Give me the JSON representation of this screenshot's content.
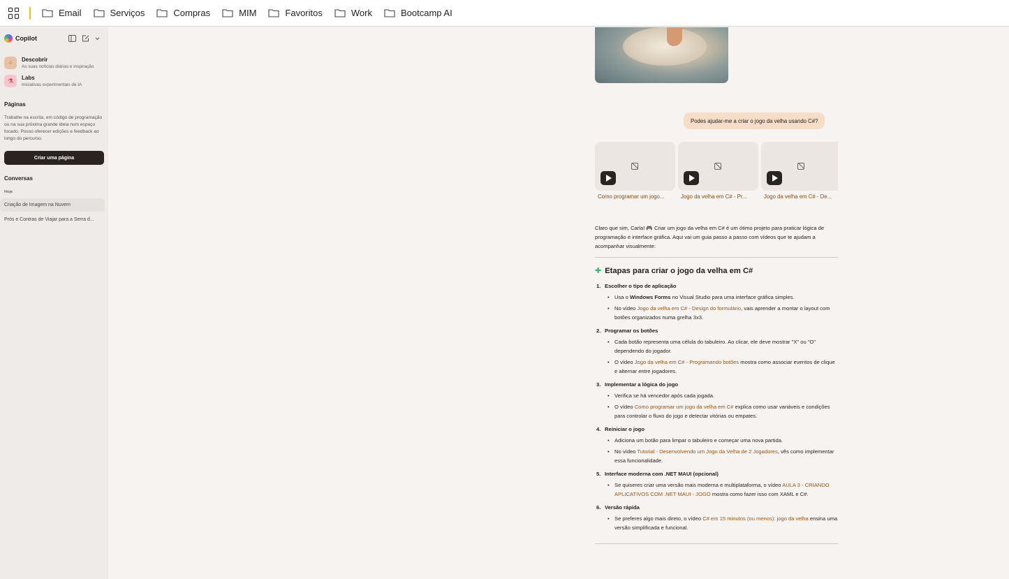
{
  "bookmarks_bar": {
    "items": [
      "Email",
      "Serviços",
      "Compras",
      "MIM",
      "Favoritos",
      "Work",
      "Bootcamp AI"
    ]
  },
  "sidebar": {
    "brand": "Copilot",
    "nav": [
      {
        "title": "Descobrir",
        "subtitle": "As suas notícias diárias e inspiração"
      },
      {
        "title": "Labs",
        "subtitle": "Iniciativas experimentais de IA"
      }
    ],
    "pages_title": "Páginas",
    "pages_text": "Trabalhe na escrita, em código de programação ou na sua próxima grande ideia num espaço focado. Posso oferecer edições e feedback ao longo do percurso.",
    "create_button": "Criar uma página",
    "conversations_title": "Conversas",
    "today_label": "Hoje",
    "conversations": [
      "Criação de Imagem na Nuvem",
      "Prós e Contras de Viajar para a Serra d..."
    ]
  },
  "chat": {
    "user_message": "Podes ajudar-me a criar o jogo da velha usando C#?",
    "videos": [
      "Como programar um jogo...",
      "Jogo da velha em C# - Pr...",
      "Jogo da velha em C# - De..."
    ],
    "intro": "Claro que sim, Carla! 🎮 Criar um jogo da velha em C# é um ótimo projeto para praticar lógica de programação e interface gráfica. Aqui vai um guia passo a passo com vídeos que te ajudam a acompanhar visualmente:",
    "heading": "Etapas para criar o jogo da velha em C#",
    "steps": [
      {
        "num": "1.",
        "title": "Escolher o tipo de aplicação"
      },
      {
        "num": "2.",
        "title": "Programar os botões"
      },
      {
        "num": "3.",
        "title": "Implementar a lógica do jogo"
      },
      {
        "num": "4.",
        "title": "Reiniciar o jogo"
      },
      {
        "num": "5.",
        "title": "Interface moderna com .NET MAUI (opcional)"
      },
      {
        "num": "6.",
        "title": "Versão rápida"
      }
    ],
    "bullets": {
      "s1b1_a": "Usa o ",
      "s1b1_b": "Windows Forms",
      "s1b1_c": " no Visual Studio para uma interface gráfica simples.",
      "s1b2_a": "No vídeo ",
      "s1b2_link": "Jogo da velha em C# - Design do formulário",
      "s1b2_c": ", vais aprender a montar o layout com botões organizados numa grelha 3x3.",
      "s2b1": "Cada botão representa uma célula do tabuleiro. Ao clicar, ele deve mostrar \"X\" ou \"O\" dependendo do jogador.",
      "s2b2_a": "O vídeo ",
      "s2b2_link": "Jogo da velha em C# - Programando botões",
      "s2b2_c": " mostra como associar eventos de clique e alternar entre jogadores.",
      "s3b1": "Verifica se há vencedor após cada jogada.",
      "s3b2_a": "O vídeo ",
      "s3b2_link": "Como programar um jogo da velha em C#",
      "s3b2_c": " explica como usar variáveis e condições para controlar o fluxo do jogo e detectar vitórias ou empates.",
      "s4b1": "Adiciona um botão para limpar o tabuleiro e começar uma nova partida.",
      "s4b2_a": "No vídeo ",
      "s4b2_link": "Tutorial - Desenvolvendo um Jogo da Velha de 2 Jogadores",
      "s4b2_c": ", vês como implementar essa funcionalidade.",
      "s5b1_a": "Se quiseres criar uma versão mais moderna e multiplataforma, o vídeo ",
      "s5b1_link": "AULA 3 - CRIANDO APLICATIVOS COM .NET MAUI - JOGO",
      "s5b1_c": " mostra como fazer isso com XAML e C#.",
      "s6b1_a": "Se preferes algo mais direto, o vídeo ",
      "s6b1_link": "C# em 15 minutos (ou menos): jogo da velha",
      "s6b1_c": " ensina uma versão simplificada e funcional."
    }
  }
}
